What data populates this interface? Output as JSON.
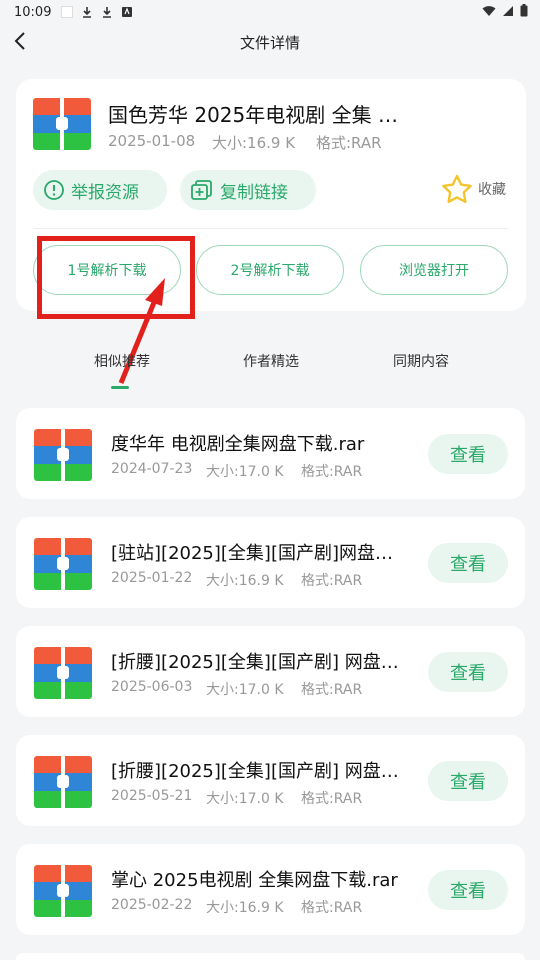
{
  "status": {
    "time": "10:09"
  },
  "header": {
    "title": "文件详情"
  },
  "file": {
    "title": "国色芳华 2025年电视剧 全集 …",
    "date": "2025-01-08",
    "size": "大小:16.9 K",
    "format": "格式:RAR"
  },
  "actions": {
    "report": "举报资源",
    "copy_link": "复制链接",
    "favorite": "收藏"
  },
  "downloads": {
    "dl1": "1号解析下载",
    "dl2": "2号解析下载",
    "browser": "浏览器打开"
  },
  "tabs": [
    "相似推荐",
    "作者精选",
    "同期内容"
  ],
  "list": [
    {
      "title": "度华年 电视剧全集网盘下载.rar",
      "date": "2024-07-23",
      "size": "大小:17.0 K",
      "format": "格式:RAR",
      "btn": "查看"
    },
    {
      "title": "[驻站][2025][全集][国产剧]网盘…",
      "date": "2025-01-22",
      "size": "大小:16.9 K",
      "format": "格式:RAR",
      "btn": "查看"
    },
    {
      "title": "[折腰][2025][全集][国产剧] 网盘…",
      "date": "2025-06-03",
      "size": "大小:17.0 K",
      "format": "格式:RAR",
      "btn": "查看"
    },
    {
      "title": "[折腰][2025][全集][国产剧] 网盘…",
      "date": "2025-05-21",
      "size": "大小:17.0 K",
      "format": "格式:RAR",
      "btn": "查看"
    },
    {
      "title": "掌心 2025电视剧 全集网盘下载.rar",
      "date": "2025-02-22",
      "size": "大小:16.9 K",
      "format": "格式:RAR",
      "btn": "查看"
    }
  ],
  "colors": {
    "accent": "#2aa96b",
    "highlight": "#e3211c",
    "zip_red": "#f15a3b",
    "zip_blue": "#2f86d6",
    "zip_green": "#2ec243"
  }
}
